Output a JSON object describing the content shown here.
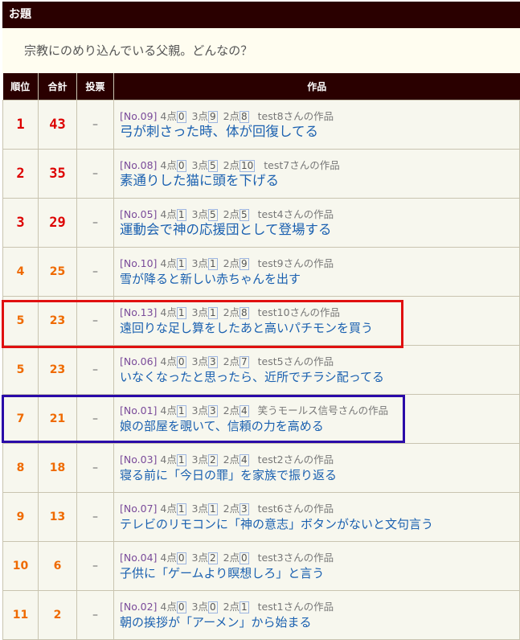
{
  "odai": {
    "header": "お題",
    "text": "宗教にのめり込んでいる父親。どんなの？"
  },
  "table": {
    "headers": {
      "rank": "順位",
      "total": "合計",
      "vote": "投票",
      "work": "作品"
    },
    "rows": [
      {
        "rank": "1",
        "total": "43",
        "vote": "–",
        "no": "[No.09]",
        "p4": "0",
        "p3": "9",
        "p2": "8",
        "author": "test8さんの作品",
        "title": "弓が刺さった時、体が回復してる"
      },
      {
        "rank": "2",
        "total": "35",
        "vote": "–",
        "no": "[No.08]",
        "p4": "0",
        "p3": "5",
        "p2": "10",
        "author": "test7さんの作品",
        "title": "素通りした猫に頭を下げる"
      },
      {
        "rank": "3",
        "total": "29",
        "vote": "–",
        "no": "[No.05]",
        "p4": "1",
        "p3": "5",
        "p2": "5",
        "author": "test4さんの作品",
        "title": "運動会で神の応援団として登場する"
      },
      {
        "rank": "4",
        "total": "25",
        "vote": "–",
        "no": "[No.10]",
        "p4": "1",
        "p3": "1",
        "p2": "9",
        "author": "test9さんの作品",
        "title": "雪が降ると新しい赤ちゃんを出す"
      },
      {
        "rank": "5",
        "total": "23",
        "vote": "–",
        "no": "[No.13]",
        "p4": "1",
        "p3": "1",
        "p2": "8",
        "author": "test10さんの作品",
        "title": "遠回りな足し算をしたあと高いパチモンを買う"
      },
      {
        "rank": "5",
        "total": "23",
        "vote": "–",
        "no": "[No.06]",
        "p4": "0",
        "p3": "3",
        "p2": "7",
        "author": "test5さんの作品",
        "title": "いなくなったと思ったら、近所でチラシ配ってる"
      },
      {
        "rank": "7",
        "total": "21",
        "vote": "–",
        "no": "[No.01]",
        "p4": "1",
        "p3": "3",
        "p2": "4",
        "author": "笑うモールス信号さんの作品",
        "title": "娘の部屋を覗いて、信頼の力を高める"
      },
      {
        "rank": "8",
        "total": "18",
        "vote": "–",
        "no": "[No.03]",
        "p4": "1",
        "p3": "2",
        "p2": "4",
        "author": "test2さんの作品",
        "title": "寝る前に「今日の罪」を家族で振り返る"
      },
      {
        "rank": "9",
        "total": "13",
        "vote": "–",
        "no": "[No.07]",
        "p4": "1",
        "p3": "1",
        "p2": "3",
        "author": "test6さんの作品",
        "title": "テレビのリモコンに「神の意志」ボタンがないと文句言う"
      },
      {
        "rank": "10",
        "total": "6",
        "vote": "–",
        "no": "[No.04]",
        "p4": "0",
        "p3": "2",
        "p2": "0",
        "author": "test3さんの作品",
        "title": "子供に「ゲームより瞑想しろ」と言う"
      },
      {
        "rank": "11",
        "total": "2",
        "vote": "–",
        "no": "[No.02]",
        "p4": "0",
        "p3": "0",
        "p2": "1",
        "author": "test1さんの作品",
        "title": "朝の挨拶が「アーメン」から始まる"
      }
    ]
  },
  "labels": {
    "p4": "4点",
    "p3": "3点",
    "p2": "2点"
  },
  "colors": {
    "header_bg": "#2a0000",
    "rank_top": "#dd0000",
    "rank_other": "#ef6a00",
    "link": "#1a60b0",
    "highlight_red": "#e01010",
    "highlight_blue": "#2a0aa8"
  }
}
